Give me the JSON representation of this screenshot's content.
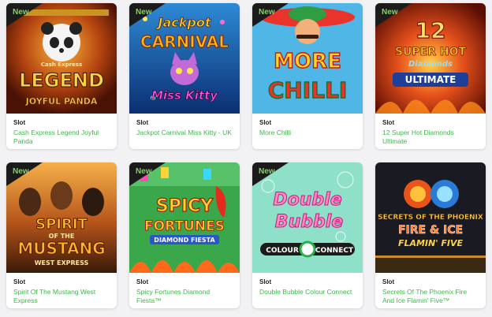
{
  "colors": {
    "badge_bg": "#1b1b1b",
    "badge_text": "#7cd957",
    "title": "#3db84a",
    "category": "#222222"
  },
  "games": [
    {
      "badge": "New",
      "category": "Slot",
      "title": "Cash Express Legend Joyful Panda",
      "art": {
        "line1": "Cash Express",
        "line2": "LEGEND",
        "line3": "JOYFUL PANDA"
      }
    },
    {
      "badge": "New",
      "category": "Slot",
      "title": "Jackpot Carnival Miss Kitty - UK",
      "art": {
        "line1": "Jackpot",
        "line2": "CARNIVAL",
        "line3": "Miss Kitty"
      }
    },
    {
      "badge": "New",
      "category": "Slot",
      "title": "More Chilli",
      "art": {
        "line1": "MORE",
        "line2": "CHILLI"
      }
    },
    {
      "badge": "New",
      "category": "Slot",
      "title": "12 Super Hot Diamonds Ultimate",
      "art": {
        "line1": "12",
        "line2": "SUPER HOT",
        "line3": "Diamonds",
        "line4": "ULTIMATE"
      }
    },
    {
      "badge": "New",
      "category": "Slot",
      "title": "Spirit Of The Mustang West Express",
      "art": {
        "line1": "SPIRIT",
        "line2": "OF THE",
        "line3": "MUSTANG",
        "line4": "WEST EXPRESS"
      }
    },
    {
      "badge": "New",
      "category": "Slot",
      "title": "Spicy Fortunes Diamond Fiesta™",
      "art": {
        "line1": "SPICY",
        "line2": "FORTUNES",
        "line3": "DIAMOND FIESTA"
      }
    },
    {
      "badge": "New",
      "category": "Slot",
      "title": "Double Bubble Colour Connect",
      "art": {
        "line1": "Double",
        "line2": "Bubble",
        "line3": "COLOUR",
        "line4": "CONNECT"
      }
    },
    {
      "badge": "",
      "category": "Slot",
      "title": "Secrets Of The Phoenix Fire And Ice Flamin' Five™",
      "art": {
        "line1": "SECRETS OF THE PHOENIX",
        "line2": "FIRE & ICE",
        "line3": "FLAMIN' FIVE"
      }
    }
  ]
}
